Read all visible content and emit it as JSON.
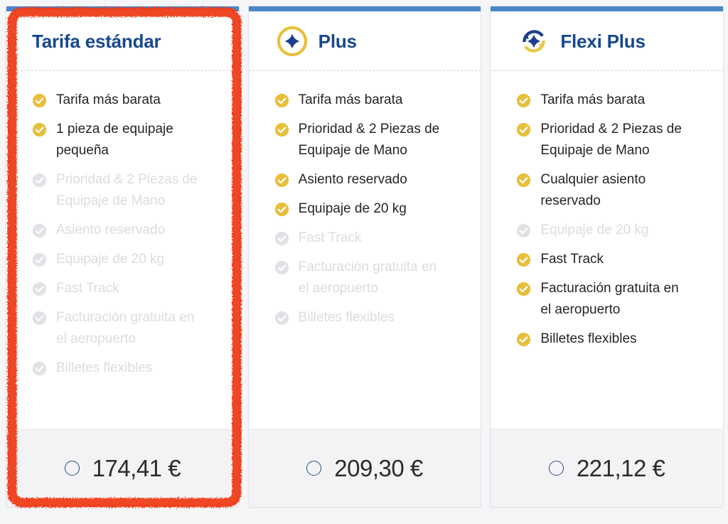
{
  "page": {
    "background_color": "#f6f6f8",
    "accent_blue": "#17488f",
    "topbar_blue": "#4a86c8",
    "check_yellow": "#e8bf3a",
    "disabled_gray": "#dcdce0",
    "annotation_color": "#ef3c1e"
  },
  "annotation": {
    "name": "red-highlight-box",
    "shape": "hand-drawn-rounded-rectangle",
    "target": "Tarifa estándar fare card"
  },
  "cards": [
    {
      "id": "tarifa-estandar",
      "title": "Tarifa estándar",
      "icon": "none",
      "has_topbar": true,
      "highlighted": true,
      "features": [
        {
          "label": "Tarifa más barata",
          "included": true
        },
        {
          "label": "1 pieza de equipaje pequeña",
          "included": true
        },
        {
          "label": "Prioridad & 2 Piezas de Equipaje de Mano",
          "included": false
        },
        {
          "label": "Asiento reservado",
          "included": false
        },
        {
          "label": "Equipaje de 20 kg",
          "included": false
        },
        {
          "label": "Fast Track",
          "included": false
        },
        {
          "label": "Facturación gratuita en el aeropuerto",
          "included": false
        },
        {
          "label": "Billetes flexibles",
          "included": false
        }
      ],
      "price": "174,41 €",
      "selected": false
    },
    {
      "id": "plus",
      "title": "Plus",
      "icon": "plus-circle-icon",
      "has_topbar": true,
      "highlighted": false,
      "features": [
        {
          "label": "Tarifa más barata",
          "included": true
        },
        {
          "label": "Prioridad & 2 Piezas de Equipaje de Mano",
          "included": true
        },
        {
          "label": "Asiento reservado",
          "included": true
        },
        {
          "label": "Equipaje de 20 kg",
          "included": true
        },
        {
          "label": "Fast Track",
          "included": false
        },
        {
          "label": "Facturación gratuita en el aeropuerto",
          "included": false
        },
        {
          "label": "Billetes flexibles",
          "included": false
        }
      ],
      "price": "209,30 €",
      "selected": false
    },
    {
      "id": "flexi-plus",
      "title": "Flexi Plus",
      "icon": "flexi-refresh-plus-icon",
      "has_topbar": true,
      "highlighted": false,
      "features": [
        {
          "label": "Tarifa más barata",
          "included": true
        },
        {
          "label": "Prioridad & 2 Piezas de Equipaje de Mano",
          "included": true
        },
        {
          "label": "Cualquier asiento reservado",
          "included": true
        },
        {
          "label": "Equipaje de 20 kg",
          "included": false
        },
        {
          "label": "Fast Track",
          "included": true
        },
        {
          "label": "Facturación gratuita en el aeropuerto",
          "included": true
        },
        {
          "label": "Billetes flexibles",
          "included": true
        }
      ],
      "price": "221,12 €",
      "selected": false
    }
  ]
}
